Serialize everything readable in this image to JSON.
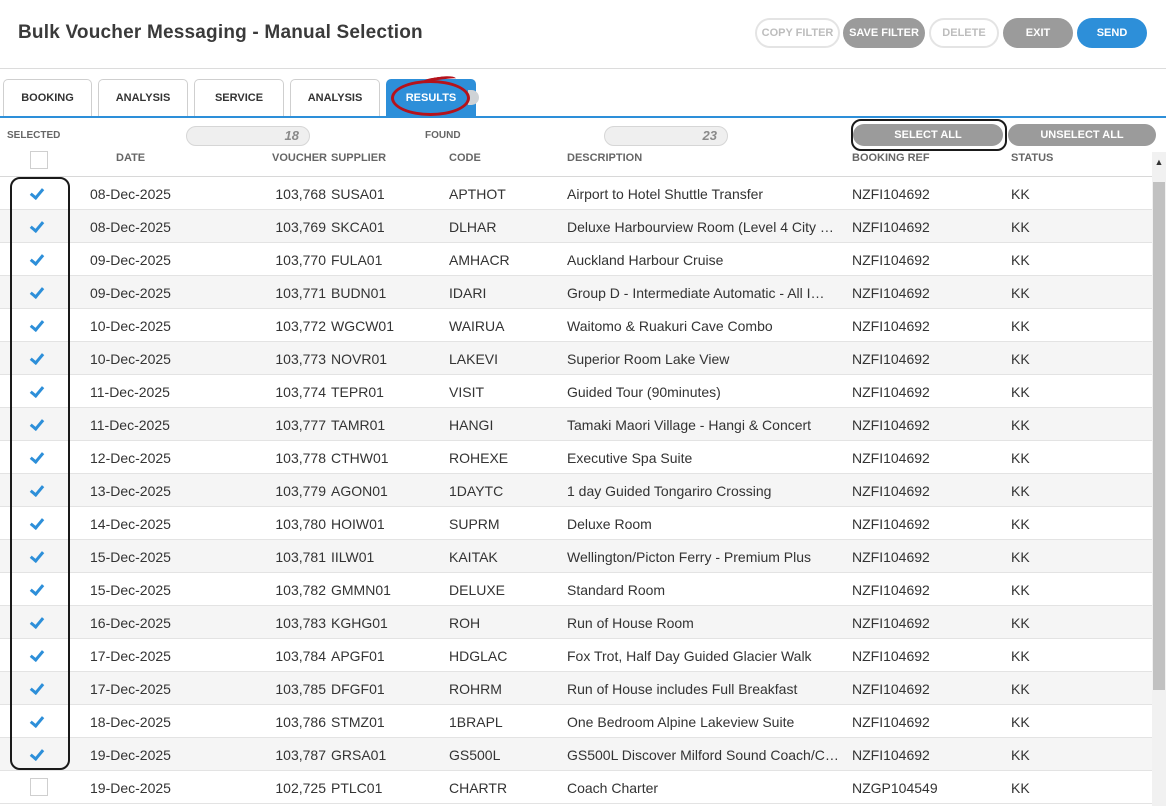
{
  "header": {
    "title": "Bulk Voucher Messaging - Manual Selection",
    "buttons": {
      "copy_filter": "COPY FILTER",
      "save_filter": "SAVE FILTER",
      "delete": "DELETE",
      "exit": "EXIT",
      "send": "SEND"
    }
  },
  "tabs": [
    {
      "label": "BOOKING"
    },
    {
      "label": "ANALYSIS"
    },
    {
      "label": "SERVICE"
    },
    {
      "label": "ANALYSIS"
    },
    {
      "label": "RESULTS"
    }
  ],
  "summary": {
    "selected_label": "SELECTED",
    "selected_value": "18",
    "found_label": "FOUND",
    "found_value": "23",
    "select_all": "SELECT ALL",
    "unselect_all": "UNSELECT ALL"
  },
  "columns": {
    "date": "DATE",
    "voucher": "VOUCHER",
    "supplier": "SUPPLIER",
    "code": "CODE",
    "description": "DESCRIPTION",
    "booking_ref": "BOOKING REF",
    "status": "STATUS"
  },
  "scrollbar": {
    "up_glyph": "▲"
  },
  "rows": [
    {
      "checked": true,
      "date": "08-Dec-2025",
      "voucher": "103,768",
      "supplier": "SUSA01",
      "code": "APTHOT",
      "description": "Airport to Hotel Shuttle Transfer",
      "booking_ref": "NZFI104692",
      "status": "KK"
    },
    {
      "checked": true,
      "date": "08-Dec-2025",
      "voucher": "103,769",
      "supplier": "SKCA01",
      "code": "DLHAR",
      "description": "Deluxe Harbourview Room (Level 4 City …",
      "booking_ref": "NZFI104692",
      "status": "KK"
    },
    {
      "checked": true,
      "date": "09-Dec-2025",
      "voucher": "103,770",
      "supplier": "FULA01",
      "code": "AMHACR",
      "description": "Auckland Harbour Cruise",
      "booking_ref": "NZFI104692",
      "status": "KK"
    },
    {
      "checked": true,
      "date": "09-Dec-2025",
      "voucher": "103,771",
      "supplier": "BUDN01",
      "code": "IDARI",
      "description": "Group D - Intermediate Automatic - All I…",
      "booking_ref": "NZFI104692",
      "status": "KK"
    },
    {
      "checked": true,
      "date": "10-Dec-2025",
      "voucher": "103,772",
      "supplier": "WGCW01",
      "code": "WAIRUA",
      "description": "Waitomo & Ruakuri Cave Combo",
      "booking_ref": "NZFI104692",
      "status": "KK"
    },
    {
      "checked": true,
      "date": "10-Dec-2025",
      "voucher": "103,773",
      "supplier": "NOVR01",
      "code": "LAKEVI",
      "description": "Superior Room Lake View",
      "booking_ref": "NZFI104692",
      "status": "KK"
    },
    {
      "checked": true,
      "date": "11-Dec-2025",
      "voucher": "103,774",
      "supplier": "TEPR01",
      "code": "VISIT",
      "description": "Guided Tour (90minutes)",
      "booking_ref": "NZFI104692",
      "status": "KK"
    },
    {
      "checked": true,
      "date": "11-Dec-2025",
      "voucher": "103,777",
      "supplier": "TAMR01",
      "code": "HANGI",
      "description": "Tamaki Maori Village - Hangi & Concert",
      "booking_ref": "NZFI104692",
      "status": "KK"
    },
    {
      "checked": true,
      "date": "12-Dec-2025",
      "voucher": "103,778",
      "supplier": "CTHW01",
      "code": "ROHEXE",
      "description": "Executive Spa Suite",
      "booking_ref": "NZFI104692",
      "status": "KK"
    },
    {
      "checked": true,
      "date": "13-Dec-2025",
      "voucher": "103,779",
      "supplier": "AGON01",
      "code": "1DAYTC",
      "description": "1 day Guided Tongariro Crossing",
      "booking_ref": "NZFI104692",
      "status": "KK"
    },
    {
      "checked": true,
      "date": "14-Dec-2025",
      "voucher": "103,780",
      "supplier": "HOIW01",
      "code": "SUPRM",
      "description": "Deluxe Room",
      "booking_ref": "NZFI104692",
      "status": "KK"
    },
    {
      "checked": true,
      "date": "15-Dec-2025",
      "voucher": "103,781",
      "supplier": "IILW01",
      "code": "KAITAK",
      "description": "Wellington/Picton Ferry - Premium Plus",
      "booking_ref": "NZFI104692",
      "status": "KK"
    },
    {
      "checked": true,
      "date": "15-Dec-2025",
      "voucher": "103,782",
      "supplier": "GMMN01",
      "code": "DELUXE",
      "description": "Standard Room",
      "booking_ref": "NZFI104692",
      "status": "KK"
    },
    {
      "checked": true,
      "date": "16-Dec-2025",
      "voucher": "103,783",
      "supplier": "KGHG01",
      "code": "ROH",
      "description": "Run of House Room",
      "booking_ref": "NZFI104692",
      "status": "KK"
    },
    {
      "checked": true,
      "date": "17-Dec-2025",
      "voucher": "103,784",
      "supplier": "APGF01",
      "code": "HDGLAC",
      "description": "Fox Trot, Half Day Guided Glacier Walk",
      "booking_ref": "NZFI104692",
      "status": "KK"
    },
    {
      "checked": true,
      "date": "17-Dec-2025",
      "voucher": "103,785",
      "supplier": "DFGF01",
      "code": "ROHRM",
      "description": "Run of House includes Full Breakfast",
      "booking_ref": "NZFI104692",
      "status": "KK"
    },
    {
      "checked": true,
      "date": "18-Dec-2025",
      "voucher": "103,786",
      "supplier": "STMZ01",
      "code": "1BRAPL",
      "description": "One Bedroom Alpine Lakeview Suite",
      "booking_ref": "NZFI104692",
      "status": "KK"
    },
    {
      "checked": true,
      "date": "19-Dec-2025",
      "voucher": "103,787",
      "supplier": "GRSA01",
      "code": "GS500L",
      "description": "GS500L Discover Milford Sound Coach/C…",
      "booking_ref": "NZFI104692",
      "status": "KK"
    },
    {
      "checked": false,
      "date": "19-Dec-2025",
      "voucher": "102,725",
      "supplier": "PTLC01",
      "code": "CHARTR",
      "description": "Coach Charter",
      "booking_ref": "NZGP104549",
      "status": "KK"
    }
  ],
  "colors": {
    "accent": "#2d8fd9",
    "button_gray": "#9b9b9b",
    "highlight_ring": "#b5121b"
  }
}
